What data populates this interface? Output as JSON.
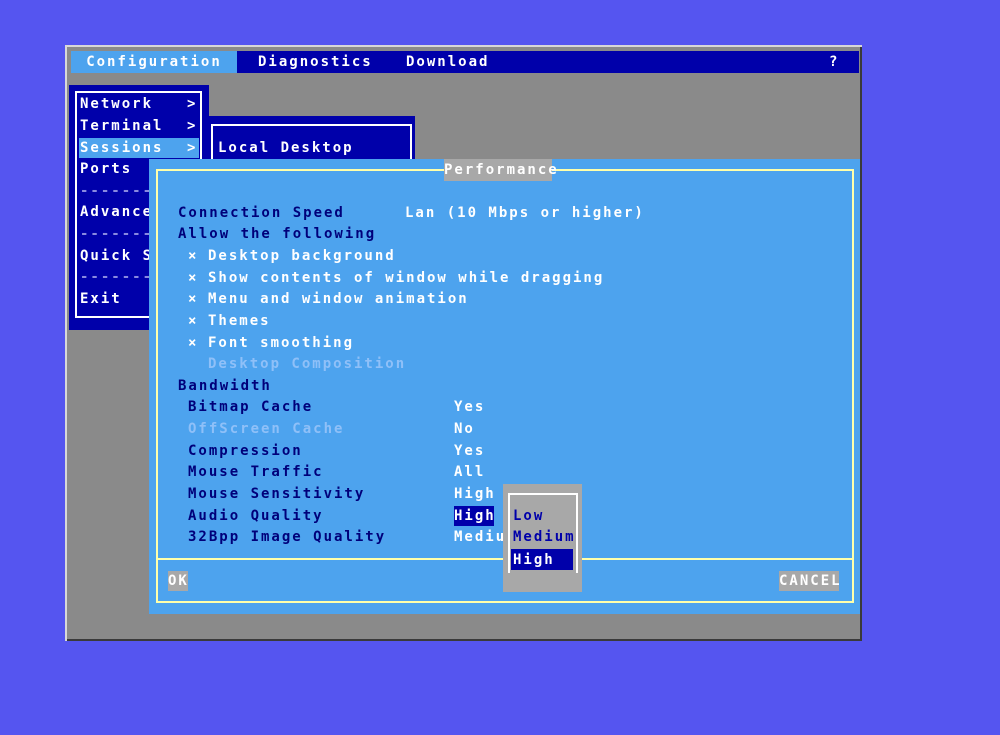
{
  "menubar": {
    "items": [
      "Configuration",
      "Diagnostics",
      "Download"
    ],
    "help": "?"
  },
  "config_menu": {
    "items": [
      "Network",
      "Terminal",
      "Sessions",
      "Ports",
      "Advance",
      "Quick S",
      "Exit"
    ],
    "separator": "-------",
    "arrow": ">",
    "selected": "Sessions"
  },
  "sessions_menu": {
    "items": [
      "Local Desktop"
    ]
  },
  "dialog": {
    "title": "Performance",
    "connection_speed_label": "Connection Speed",
    "connection_speed_value": "Lan (10 Mbps or higher)",
    "allow_heading": "Allow the following",
    "check_mark": "×",
    "allow": [
      {
        "label": "Desktop background",
        "checked": true
      },
      {
        "label": "Show contents of window while dragging",
        "checked": true
      },
      {
        "label": "Menu and window animation",
        "checked": true
      },
      {
        "label": "Themes",
        "checked": true
      },
      {
        "label": "Font smoothing",
        "checked": true
      },
      {
        "label": "Desktop Composition",
        "checked": false,
        "disabled": true
      }
    ],
    "bandwidth_heading": "Bandwidth",
    "bandwidth": [
      {
        "label": "Bitmap Cache",
        "value": "Yes"
      },
      {
        "label": "OffScreen Cache",
        "value": "No",
        "disabled": true
      },
      {
        "label": "Compression",
        "value": "Yes"
      },
      {
        "label": "Mouse Traffic",
        "value": "All"
      },
      {
        "label": "Mouse Sensitivity",
        "value": "High"
      },
      {
        "label": "Audio Quality",
        "value": "High"
      },
      {
        "label": "32Bpp Image Quality",
        "value": "Mediu"
      }
    ],
    "dropdown": {
      "options": [
        "Low",
        "Medium",
        "High"
      ],
      "selected": "High"
    },
    "ok_label": "OK",
    "cancel_label": "CANCEL"
  },
  "colors": {
    "desktop": "#5555f0",
    "menu_bg": "#0000aa",
    "dialog_bg": "#4da3ee",
    "frame": "#ffffaa",
    "button_bg": "#a8a8a8"
  }
}
